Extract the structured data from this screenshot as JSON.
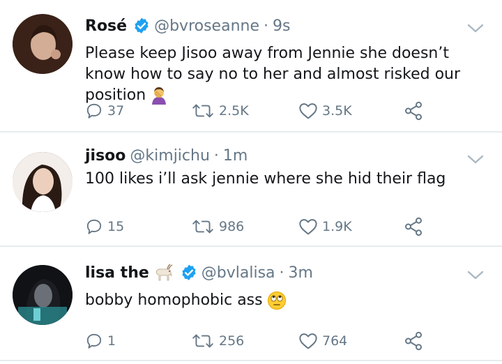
{
  "icons": {
    "verified": "verified-badge-icon",
    "caret": "chevron-down-icon",
    "reply": "reply-icon",
    "retweet": "retweet-icon",
    "like": "heart-icon",
    "share": "share-icon"
  },
  "colors": {
    "text": "#14171a",
    "muted": "#657786",
    "divider": "#e6ecf0",
    "verified": "#1da1f2"
  },
  "tweets": [
    {
      "name": "Rosé",
      "handle": "@bvroseanne",
      "dot": "·",
      "time": "9s",
      "verified": true,
      "text": "Please keep Jisoo away from Jennie she doesn’t know how to say no to her and almost risked our position",
      "replies": "37",
      "retweets": "2.5K",
      "likes": "3.5K"
    },
    {
      "name": "jisoo",
      "handle": "@kimjichu",
      "dot": "·",
      "time": "1m",
      "verified": false,
      "text": "100 likes i’ll ask jennie where she hid their flag",
      "replies": "15",
      "retweets": "986",
      "likes": "1.9K"
    },
    {
      "name": "lisa the",
      "handle": "@bvlalisa",
      "dot": "·",
      "time": "3m",
      "verified": true,
      "text": "bobby homophobic ass",
      "replies": "1",
      "retweets": "256",
      "likes": "764"
    }
  ]
}
